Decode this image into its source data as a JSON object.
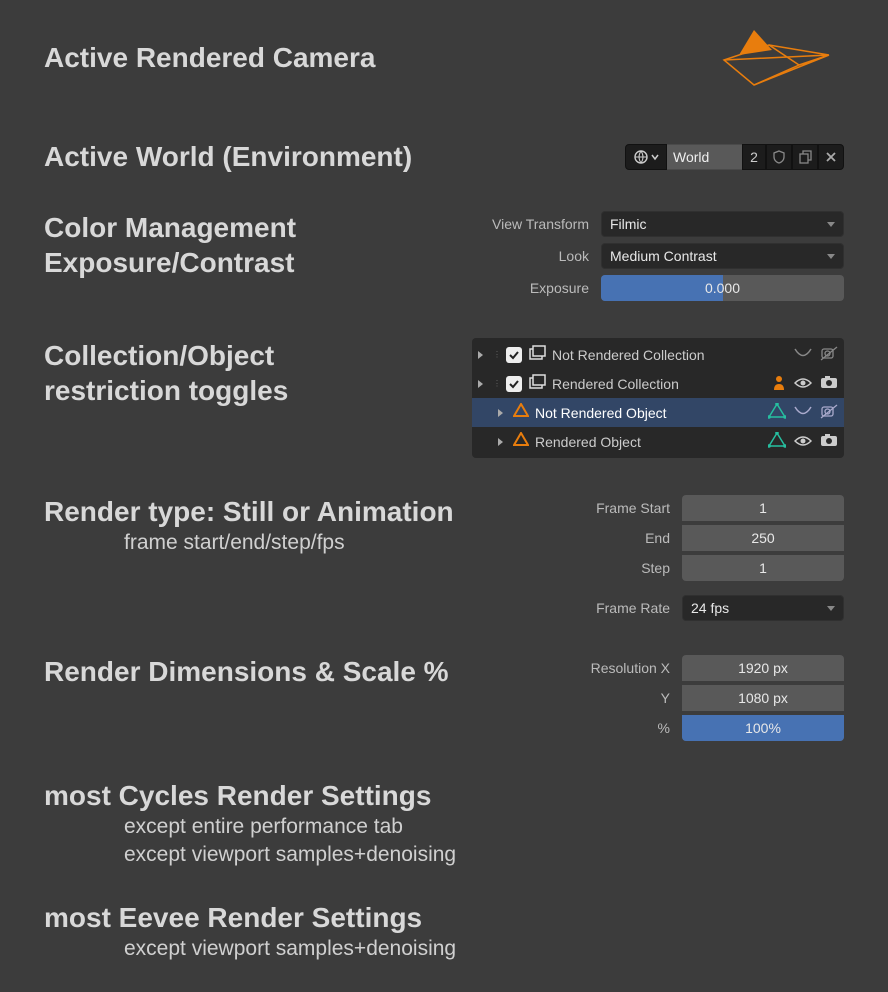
{
  "sections": {
    "camera": {
      "title": "Active Rendered Camera"
    },
    "world": {
      "title": "Active World (Environment)",
      "selector_name": "World",
      "users": "2"
    },
    "colormgmt": {
      "title1": "Color Management",
      "title2": "Exposure/Contrast",
      "view_transform_label": "View Transform",
      "view_transform_value": "Filmic",
      "look_label": "Look",
      "look_value": "Medium Contrast",
      "exposure_label": "Exposure",
      "exposure_value": "0.000"
    },
    "restriction": {
      "title1": "Collection/Object",
      "title2": "restriction toggles",
      "rows": [
        {
          "type": "collection",
          "name": "Not Rendered Collection",
          "rendered": false
        },
        {
          "type": "collection",
          "name": "Rendered Collection",
          "rendered": true
        },
        {
          "type": "object",
          "name": "Not Rendered Object",
          "rendered": false,
          "active": true
        },
        {
          "type": "object",
          "name": "Rendered Object",
          "rendered": true
        }
      ]
    },
    "rendertype": {
      "title": "Render type: Still or Animation",
      "sub": "frame start/end/step/fps",
      "frame_start_label": "Frame Start",
      "frame_start": "1",
      "end_label": "End",
      "end": "250",
      "step_label": "Step",
      "step": "1",
      "frame_rate_label": "Frame Rate",
      "frame_rate": "24 fps"
    },
    "dims": {
      "title": "Render Dimensions & Scale %",
      "resx_label": "Resolution X",
      "resx": "1920 px",
      "resy_label": "Y",
      "resy": "1080 px",
      "pct_label": "%",
      "pct": "100%"
    },
    "cycles": {
      "title": "most Cycles Render Settings",
      "sub1": "except entire performance tab",
      "sub2": "except viewport samples+denoising"
    },
    "eevee": {
      "title": "most Eevee Render Settings",
      "sub1": "except viewport samples+denoising"
    }
  }
}
